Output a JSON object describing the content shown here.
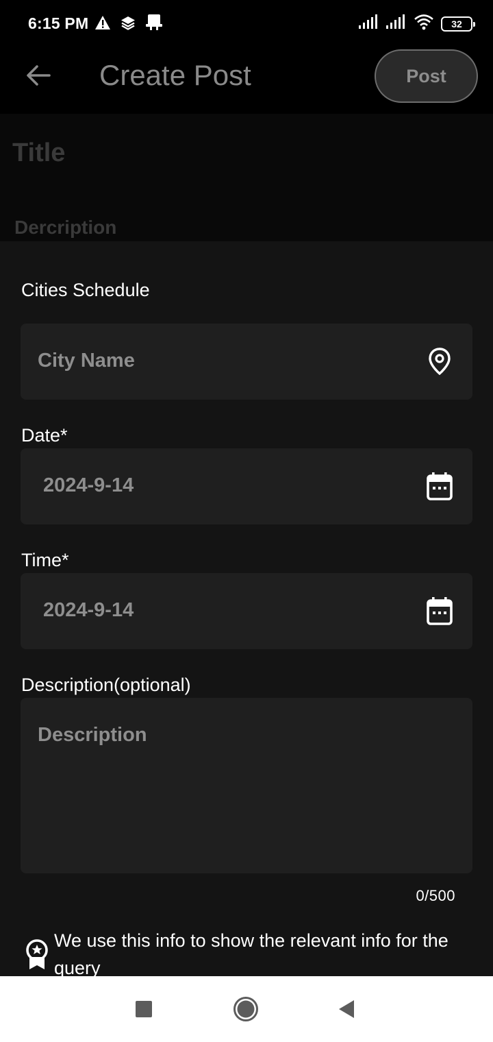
{
  "status_bar": {
    "time": "6:15 PM",
    "left_icons": [
      "alert-icon",
      "layers-icon",
      "notification-icon"
    ],
    "right_icons": [
      "signal-icon",
      "signal-icon",
      "wifi-icon"
    ],
    "battery": "32"
  },
  "app_bar": {
    "title": "Create Post",
    "post_label": "Post",
    "back_icon": "arrow-back-icon"
  },
  "post_form": {
    "title_placeholder": "Title",
    "description_placeholder": "Dercription"
  },
  "sheet": {
    "section_title": "Cities Schedule",
    "city": {
      "placeholder": "City Name",
      "icon": "location-pin-icon"
    },
    "date": {
      "label": "Date*",
      "value": "2024-9-14",
      "icon": "calendar-icon"
    },
    "time": {
      "label": "Time*",
      "value": "2024-9-14",
      "icon": "calendar-icon"
    },
    "description": {
      "label": "Description(optional)",
      "placeholder": "Description",
      "counter": "0/500"
    },
    "info": {
      "icon": "badge-icon",
      "text": "We use this info to show the relevant info for the query"
    }
  },
  "nav_bar": {
    "buttons": [
      "recents-icon",
      "home-icon",
      "back-icon"
    ]
  },
  "colors": {
    "background": "#000000",
    "sheet": "#141414",
    "field": "#1f1f1f",
    "muted_text": "#8e8e8e"
  }
}
